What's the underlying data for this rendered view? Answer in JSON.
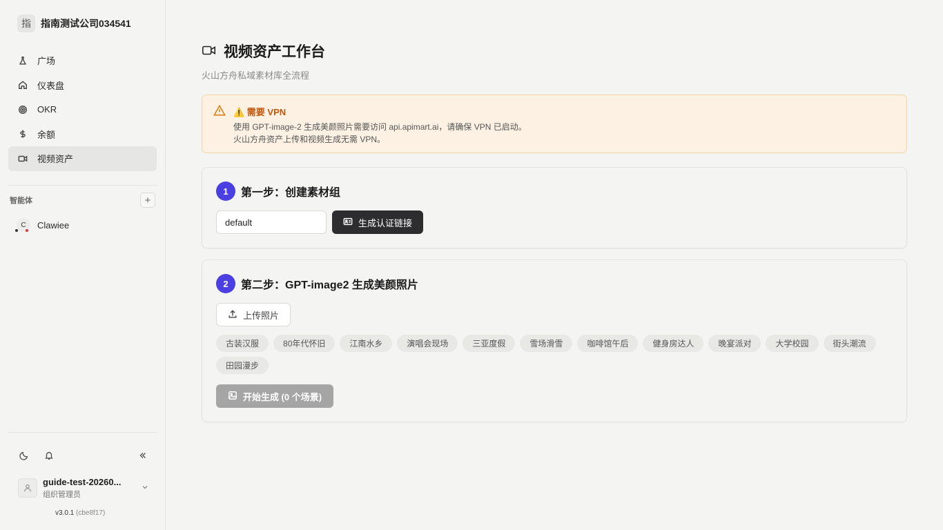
{
  "org": {
    "logo_char": "指",
    "name": "指南测试公司034541"
  },
  "nav": [
    {
      "label": "广场",
      "icon": "flask-icon"
    },
    {
      "label": "仪表盘",
      "icon": "home-icon"
    },
    {
      "label": "OKR",
      "icon": "target-icon"
    },
    {
      "label": "余额",
      "icon": "dollar-icon"
    },
    {
      "label": "视频资产",
      "icon": "video-icon",
      "active": true
    }
  ],
  "agents": {
    "title": "智能体",
    "add_label": "+",
    "items": [
      {
        "avatar": "C",
        "name": "Clawiee"
      }
    ]
  },
  "user": {
    "name": "guide-test-20260...",
    "role": "组织管理员"
  },
  "version": {
    "number": "v3.0.1",
    "hash": "(cbe8f17)"
  },
  "page": {
    "title": "视频资产工作台",
    "subtitle": "火山方舟私域素材库全流程"
  },
  "alert": {
    "title": "⚠️ 需要 VPN",
    "line1": "使用 GPT-image-2 生成美颜照片需要访问 api.apimart.ai，请确保 VPN 已启动。",
    "line2": "火山方舟资产上传和视频生成无需 VPN。",
    "color": "#d97706"
  },
  "step1": {
    "number": "1",
    "title": "第一步：创建素材组",
    "input_value": "default",
    "button_label": "生成认证链接"
  },
  "step2": {
    "number": "2",
    "title": "第二步：GPT-image2 生成美颜照片",
    "upload_label": "上传照片",
    "scenes": [
      "古装汉服",
      "80年代怀旧",
      "江南水乡",
      "演唱会现场",
      "三亚度假",
      "雪场滑雪",
      "咖啡馆午后",
      "健身房达人",
      "晚宴派对",
      "大学校园",
      "街头潮流",
      "田园漫步"
    ],
    "generate_label": "开始生成 (0 个场景)"
  },
  "colors": {
    "accent": "#4a3fe0",
    "dark_button": "#2d2d30"
  }
}
